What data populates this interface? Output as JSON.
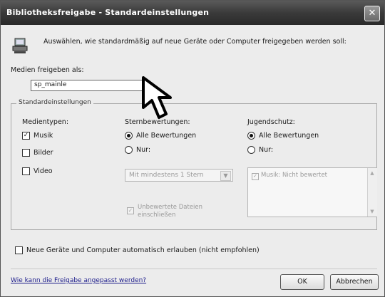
{
  "window": {
    "title": "Bibliotheksfreigabe - Standardeinstellungen",
    "close_glyph": "✕"
  },
  "intro": {
    "text": "Auswählen, wie standardmäßig auf neue Geräte oder Computer freigegeben werden soll:"
  },
  "media_name": {
    "label": "Medien freigeben als:",
    "value": "sp_mainle"
  },
  "group": {
    "legend": "Standardeinstellungen"
  },
  "media_types": {
    "heading": "Medientypen:",
    "items": [
      {
        "label": "Musik",
        "checked": true
      },
      {
        "label": "Bilder",
        "checked": false
      },
      {
        "label": "Video",
        "checked": false
      }
    ],
    "check_glyph": "✓"
  },
  "star_ratings": {
    "heading": "Sternbewertungen:",
    "options": [
      {
        "label": "Alle Bewertungen",
        "selected": true
      },
      {
        "label": "Nur:",
        "selected": false
      }
    ],
    "select_value": "Mit mindestens 1 Stern",
    "select_arrow": "▼",
    "unrated_label": "Unbewertete Dateien einschließen",
    "unrated_checked": true
  },
  "parental": {
    "heading": "Jugendschutz:",
    "options": [
      {
        "label": "Alle Bewertungen",
        "selected": true
      },
      {
        "label": "Nur:",
        "selected": false
      }
    ],
    "list_items": [
      "Musik: Nicht bewertet"
    ],
    "scroll_up": "▲",
    "scroll_down": "▼"
  },
  "auto_allow": {
    "label": "Neue Geräte und Computer automatisch erlauben (nicht empfohlen)",
    "checked": false
  },
  "footer": {
    "link": "Wie kann die Freigabe angepasst werden?",
    "ok_label": "OK",
    "cancel_label": "Abbrechen"
  },
  "colors": {
    "titlebar": "#3a3a3a",
    "dialog_bg": "#ececec"
  }
}
